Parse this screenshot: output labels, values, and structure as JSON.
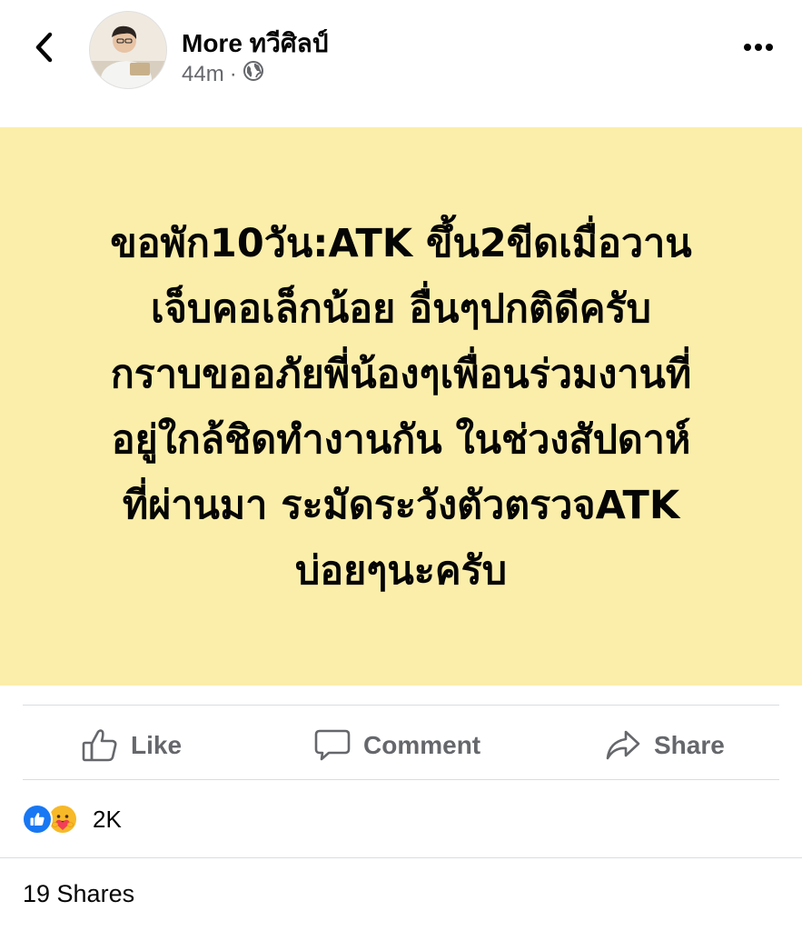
{
  "post": {
    "author_name": "More ทวีศิลป์",
    "time": "44m",
    "separator": "·",
    "audience_icon": "globe-icon",
    "text": "ขอพัก10วัน:ATK ขึ้น2ขีดเมื่อวาน\nเจ็บคอเล็กน้อย อื่นๆปกติดีครับ\nกราบขออภัยพี่น้องๆเพื่อนร่วมงานที่\nอยู่ใกล้ชิดทำงานกัน ในช่วงสัปดาห์\nที่ผ่านมา ระมัดระวังตัวตรวจATK\nบ่อยๆนะครับ",
    "background_color": "#fbeeaa"
  },
  "actions": {
    "like_label": "Like",
    "comment_label": "Comment",
    "share_label": "Share"
  },
  "engagement": {
    "reaction_icons": [
      "like-reaction-icon",
      "care-reaction-icon"
    ],
    "reaction_count": "2K",
    "shares_label": "19 Shares"
  },
  "colors": {
    "secondary_text": "#65676b",
    "like_blue": "#1877f2",
    "care_yellow": "#f7b928"
  }
}
